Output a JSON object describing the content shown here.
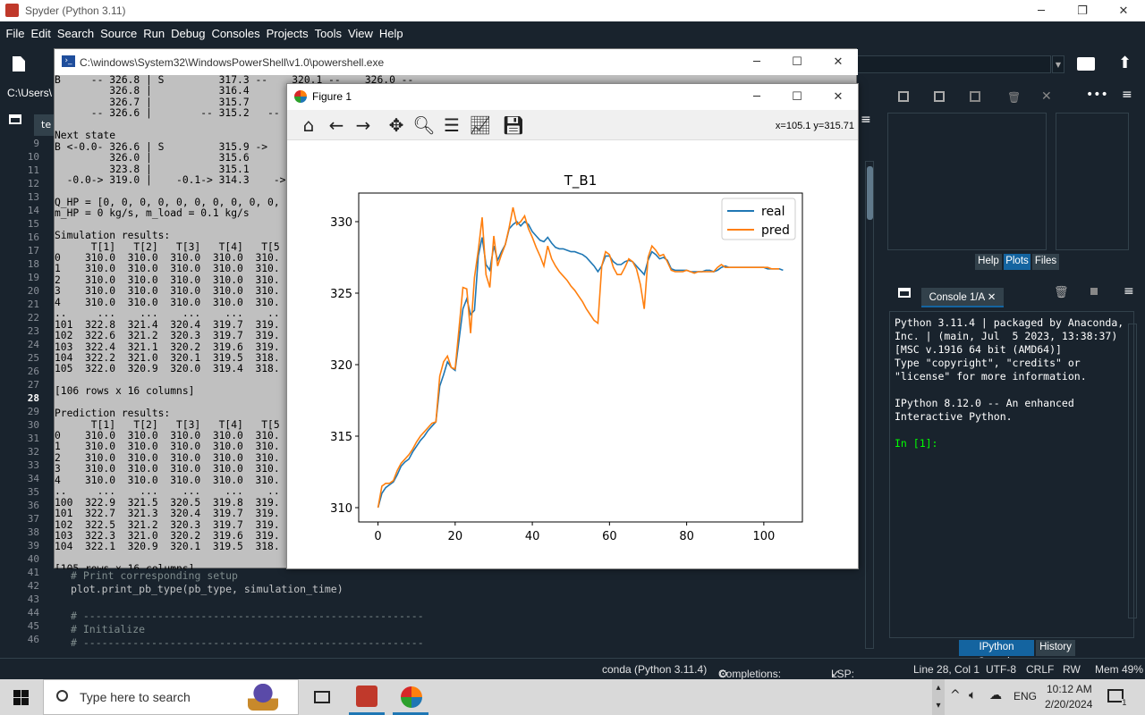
{
  "window": {
    "title": "Spyder (Python 3.11)"
  },
  "menu": [
    "File",
    "Edit",
    "Search",
    "Source",
    "Run",
    "Debug",
    "Consoles",
    "Projects",
    "Tools",
    "View",
    "Help"
  ],
  "editor": {
    "path_fragment": "C:\\Users\\",
    "tab_fragment": "te",
    "line_numbers": [
      "9",
      "10",
      "11",
      "12",
      "13",
      "14",
      "15",
      "16",
      "17",
      "18",
      "19",
      "20",
      "21",
      "22",
      "23",
      "24",
      "25",
      "26",
      "27",
      "28",
      "29",
      "30",
      "31",
      "32",
      "33",
      "34",
      "35",
      "36",
      "37",
      "38",
      "39",
      "40",
      "41",
      "42",
      "43",
      "44",
      "45",
      "46"
    ],
    "current_line": "28",
    "code": [
      "# Print corresponding setup",
      "plot.print_pb_type(pb_type, simulation_time)",
      "",
      "# -------------------------------------------------------",
      "# Initialize",
      "# -------------------------------------------------------"
    ]
  },
  "powershell": {
    "title": "C:\\windows\\System32\\WindowsPowerShell\\v1.0\\powershell.exe",
    "lines": [
      "B     -- 326.8 | S         317.3 --    320.1 --    326.0 --",
      "         326.8 |           316.4",
      "         326.7 |           315.7",
      "      -- 326.6 |        -- 315.2   --",
      "",
      "Next state",
      "B <-0.0- 326.6 | S         315.9 ->",
      "         326.0 |           315.6",
      "         323.8 |           315.1",
      "  -0.0-> 319.0 |    -0.1-> 314.3    ->",
      "",
      "Q_HP = [0, 0, 0, 0, 0, 0, 0, 0, 0, 0,",
      "m_HP = 0 kg/s, m_load = 0.1 kg/s",
      "",
      "Simulation results:",
      "      T[1]   T[2]   T[3]   T[4]   T[5",
      "0    310.0  310.0  310.0  310.0  310.",
      "1    310.0  310.0  310.0  310.0  310.",
      "2    310.0  310.0  310.0  310.0  310.",
      "3    310.0  310.0  310.0  310.0  310.",
      "4    310.0  310.0  310.0  310.0  310.",
      "..     ...    ...    ...    ...    ..",
      "101  322.8  321.4  320.4  319.7  319.",
      "102  322.6  321.2  320.3  319.7  319.",
      "103  322.4  321.1  320.2  319.6  319.",
      "104  322.2  321.0  320.1  319.5  318.",
      "105  322.0  320.9  320.0  319.4  318.",
      "",
      "[106 rows x 16 columns]",
      "",
      "Prediction results:",
      "      T[1]   T[2]   T[3]   T[4]   T[5",
      "0    310.0  310.0  310.0  310.0  310.",
      "1    310.0  310.0  310.0  310.0  310.",
      "2    310.0  310.0  310.0  310.0  310.",
      "3    310.0  310.0  310.0  310.0  310.",
      "4    310.0  310.0  310.0  310.0  310.",
      "..     ...    ...    ...    ...    ..",
      "100  322.9  321.5  320.5  319.8  319.",
      "101  322.7  321.3  320.4  319.7  319.",
      "102  322.5  321.2  320.3  319.7  319.",
      "103  322.3  321.0  320.2  319.6  319.",
      "104  322.1  320.9  320.1  319.5  318.",
      "",
      "[105 rows x 16 columns]"
    ]
  },
  "figure": {
    "title": "Figure 1",
    "coord_readout": "x=105.1 y=315.71",
    "toolbar_icons": [
      "home-icon",
      "back-icon",
      "forward-icon",
      "pan-icon",
      "zoom-icon",
      "configure-icon",
      "edit-axis-icon",
      "save-icon"
    ]
  },
  "chart_data": {
    "type": "line",
    "title": "T_B1",
    "xlabel": "",
    "ylabel": "",
    "xlim": [
      -5,
      110
    ],
    "ylim": [
      309,
      332
    ],
    "xticks": [
      0,
      20,
      40,
      60,
      80,
      100
    ],
    "yticks": [
      310,
      315,
      320,
      325,
      330
    ],
    "legend_position": "top-right",
    "series": [
      {
        "name": "real",
        "color": "#1f77b4",
        "x": [
          0,
          1,
          2,
          3,
          4,
          5,
          6,
          7,
          8,
          9,
          10,
          11,
          12,
          13,
          14,
          15,
          16,
          17,
          18,
          19,
          20,
          21,
          22,
          23,
          24,
          25,
          26,
          27,
          28,
          29,
          30,
          31,
          32,
          33,
          34,
          35,
          36,
          37,
          38,
          39,
          40,
          41,
          42,
          43,
          44,
          45,
          46,
          47,
          48,
          49,
          50,
          51,
          52,
          53,
          54,
          55,
          56,
          57,
          58,
          59,
          60,
          61,
          62,
          63,
          64,
          65,
          66,
          67,
          68,
          69,
          70,
          71,
          72,
          73,
          74,
          75,
          76,
          77,
          78,
          79,
          80,
          81,
          82,
          83,
          84,
          85,
          86,
          87,
          88,
          89,
          90,
          91,
          92,
          93,
          94,
          95,
          96,
          97,
          98,
          99,
          100,
          101,
          102,
          103,
          104,
          105
        ],
        "y": [
          310.0,
          311.0,
          311.4,
          311.6,
          311.8,
          312.3,
          312.9,
          313.2,
          313.4,
          313.9,
          314.3,
          314.7,
          315.0,
          315.4,
          315.7,
          316.0,
          318.5,
          319.3,
          320.2,
          319.8,
          319.6,
          321.7,
          323.9,
          324.6,
          323.5,
          323.8,
          327.6,
          328.9,
          327.0,
          326.6,
          328.3,
          327.3,
          327.9,
          328.4,
          329.5,
          329.8,
          330.0,
          329.7,
          330.0,
          329.8,
          329.3,
          329.0,
          328.7,
          328.6,
          328.9,
          328.5,
          328.2,
          328.1,
          328.1,
          328.0,
          327.9,
          327.9,
          327.8,
          327.7,
          327.5,
          327.2,
          326.9,
          326.5,
          326.9,
          327.6,
          327.6,
          327.2,
          327.0,
          327.0,
          327.2,
          327.3,
          327.2,
          326.9,
          326.6,
          326.3,
          327.3,
          327.9,
          327.7,
          327.4,
          327.5,
          327.3,
          326.7,
          326.6,
          326.6,
          326.6,
          326.6,
          326.5,
          326.5,
          326.5,
          326.5,
          326.6,
          326.6,
          326.5,
          326.6,
          326.8,
          326.9,
          326.8,
          326.8,
          326.8,
          326.8,
          326.8,
          326.8,
          326.8,
          326.8,
          326.8,
          326.8,
          326.7,
          326.7,
          326.7,
          326.7,
          326.6
        ]
      },
      {
        "name": "pred",
        "color": "#ff7f0e",
        "x": [
          0,
          1,
          2,
          3,
          4,
          5,
          6,
          7,
          8,
          9,
          10,
          11,
          12,
          13,
          14,
          15,
          16,
          17,
          18,
          19,
          20,
          21,
          22,
          23,
          24,
          25,
          26,
          27,
          28,
          29,
          30,
          31,
          32,
          33,
          34,
          35,
          36,
          37,
          38,
          39,
          40,
          41,
          42,
          43,
          44,
          45,
          46,
          47,
          48,
          49,
          50,
          51,
          52,
          53,
          54,
          55,
          56,
          57,
          58,
          59,
          60,
          61,
          62,
          63,
          64,
          65,
          66,
          67,
          68,
          69,
          70,
          71,
          72,
          73,
          74,
          75,
          76,
          77,
          78,
          79,
          80,
          81,
          82,
          83,
          84,
          85,
          86,
          87,
          88,
          89,
          90,
          91,
          92,
          93,
          94,
          95,
          96,
          97,
          98,
          99,
          100,
          101,
          102,
          103,
          104
        ],
        "y": [
          310.0,
          311.5,
          311.7,
          311.7,
          311.9,
          312.6,
          313.1,
          313.4,
          313.7,
          314.1,
          314.6,
          315.0,
          315.3,
          315.6,
          315.9,
          316.0,
          319.2,
          320.2,
          320.6,
          319.8,
          319.7,
          322.5,
          325.4,
          325.3,
          322.2,
          326.1,
          328.0,
          330.3,
          326.3,
          325.4,
          329.0,
          326.9,
          327.7,
          328.4,
          329.6,
          331.0,
          329.8,
          330.0,
          330.4,
          329.5,
          328.9,
          328.2,
          327.6,
          326.9,
          328.3,
          327.4,
          326.9,
          326.5,
          326.2,
          325.9,
          325.5,
          325.2,
          324.8,
          324.4,
          323.9,
          323.5,
          323.1,
          322.9,
          326.9,
          327.9,
          327.7,
          326.8,
          326.3,
          326.3,
          326.8,
          327.4,
          327.2,
          326.7,
          325.6,
          323.9,
          327.5,
          328.3,
          328.0,
          327.6,
          327.7,
          327.2,
          326.6,
          326.5,
          326.5,
          326.5,
          326.6,
          326.5,
          326.4,
          326.5,
          326.5,
          326.5,
          326.5,
          326.5,
          326.8,
          327.0,
          326.8,
          326.8,
          326.8,
          326.8,
          326.8,
          326.8,
          326.8,
          326.8,
          326.8,
          326.8,
          326.8,
          326.8,
          326.7,
          326.7,
          326.7
        ]
      }
    ]
  },
  "right_panel": {
    "top_tabs": [
      "Help",
      "Plots",
      "Files"
    ],
    "active_top_tab": "Plots",
    "console_tab": "Console 1/A",
    "console_text": "Python 3.11.4 | packaged by Anaconda, Inc. | (main, Jul  5 2023, 13:38:37) [MSC v.1916 64 bit (AMD64)]\nType \"copyright\", \"credits\" or \"license\" for more information.\n\nIPython 8.12.0 -- An enhanced Interactive Python.\n\n",
    "prompt": "In [1]:",
    "bottom_tabs": [
      "IPython Console",
      "History"
    ]
  },
  "statusbar": {
    "env": "conda (Python 3.11.4)",
    "completions": "Completions: conda",
    "lsp": "LSP: Python",
    "position": "Line 28, Col 1",
    "encoding": "UTF-8",
    "eol": "CRLF",
    "rw": "RW",
    "mem": "Mem 49%"
  },
  "taskbar": {
    "search_placeholder": "Type here to search",
    "lang": "ENG",
    "time": "10:12 AM",
    "date": "2/20/2024",
    "notif_count": "1"
  },
  "colors": {
    "real": "#1f77b4",
    "pred": "#ff7f0e",
    "accent": "#1464a0"
  }
}
